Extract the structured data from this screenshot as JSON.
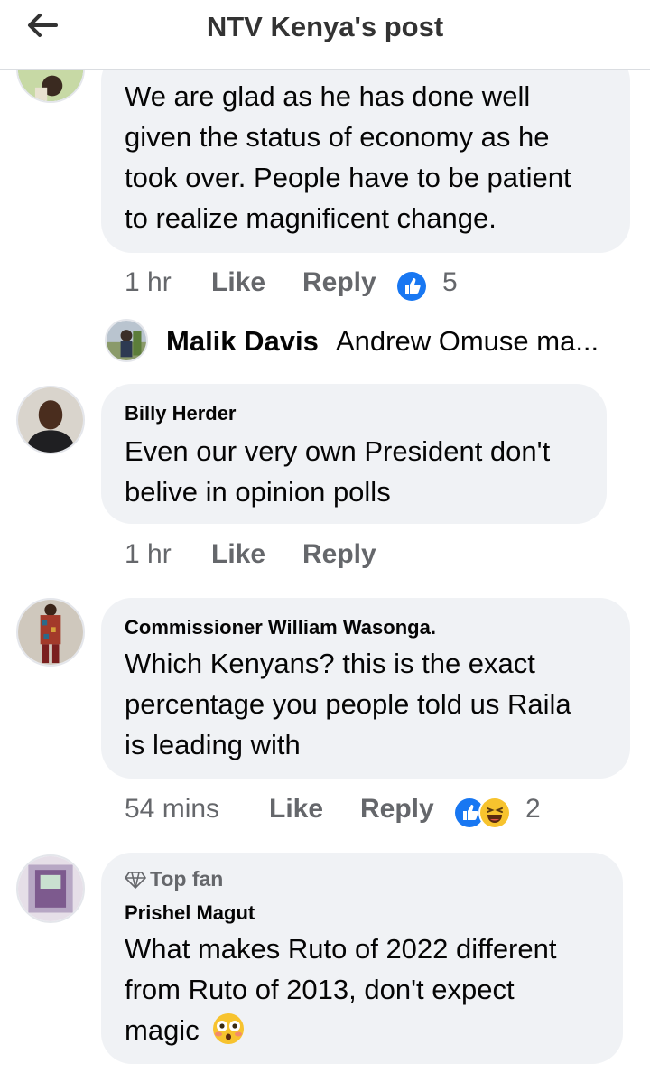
{
  "header": {
    "title": "NTV Kenya's post"
  },
  "comments": [
    {
      "author": "",
      "lines": [
        "We are glad as he has done well",
        "given the status of economy as he",
        "took over. People have to be patient",
        "to realize magnificent change."
      ],
      "time": "1 hr",
      "like_label": "Like",
      "reply_label": "Reply",
      "reaction_count": "5",
      "reactions": [
        "like-icon"
      ]
    },
    {
      "author": "Billy Herder",
      "lines": [
        "Even our very own President don't",
        "belive in opinion polls"
      ],
      "time": "1 hr",
      "like_label": "Like",
      "reply_label": "Reply"
    },
    {
      "author": "Commissioner William Wasonga.",
      "lines": [
        "Which Kenyans? this is the exact",
        "percentage you people told us Raila",
        "is leading with"
      ],
      "time": "54 mins",
      "like_label": "Like",
      "reply_label": "Reply",
      "reaction_count": "2",
      "reactions": [
        "like-icon",
        "laughing-icon"
      ]
    },
    {
      "badge": "Top fan",
      "author": "Prishel Magut",
      "lines": [
        "What makes Ruto of 2022 different",
        "from Ruto of 2013, don't expect",
        "magic"
      ],
      "emoji": "flushed-face-icon"
    }
  ],
  "reply_preview": {
    "name": "Malik Davis",
    "snippet": "Andrew Omuse ma..."
  },
  "colors": {
    "bubble": "#f0f2f5",
    "like_blue": "#1877f2",
    "muted": "#65676b",
    "laugh_yellow": "#f7c32e"
  }
}
